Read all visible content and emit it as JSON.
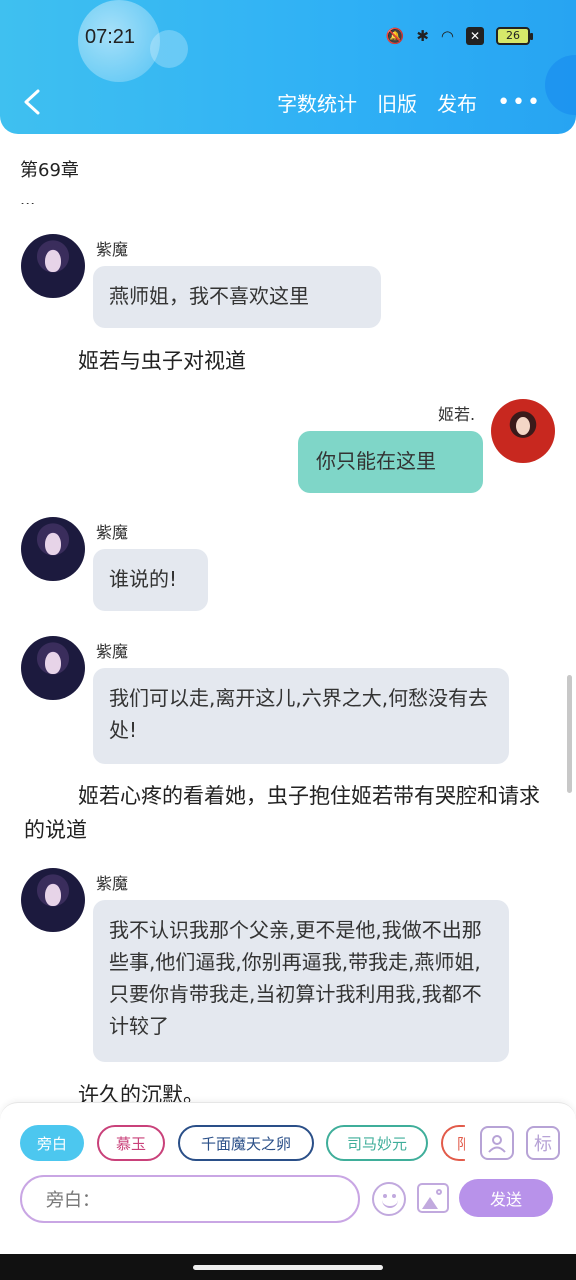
{
  "status_bar": {
    "time": "07:21",
    "battery": "26"
  },
  "header": {
    "actions": [
      "字数统计",
      "旧版",
      "发布"
    ],
    "more": "•••"
  },
  "chapter": "第69章",
  "cut_text": "...",
  "messages": [
    {
      "speaker": "紫魔",
      "text": "燕师姐，我不喜欢这里"
    },
    {
      "narration": "姬若与虫子对视道"
    },
    {
      "speaker": "姬若.",
      "text": "你只能在这里"
    },
    {
      "speaker": "紫魔",
      "text": "谁说的!"
    },
    {
      "speaker": "紫魔",
      "text": "我们可以走,离开这儿,六界之大,何愁没有去处!"
    },
    {
      "narration": "姬若心疼的看着她，虫子抱住姬若带有哭腔和请求的说道"
    },
    {
      "speaker": "紫魔",
      "text": "我不认识我那个父亲,更不是他,我做不出那些事,他们逼我,你别再逼我,带我走,燕师姐,只要你肯带我走,当初算计我利用我,我都不计较了"
    },
    {
      "narration": "许久的沉默。"
    }
  ],
  "roles": [
    "旁白",
    "慕玉",
    "千面魔天之卵",
    "司马妙元",
    "阳"
  ],
  "role_icon_label": "标",
  "input": {
    "placeholder": "旁白："
  },
  "send_label": "发送"
}
